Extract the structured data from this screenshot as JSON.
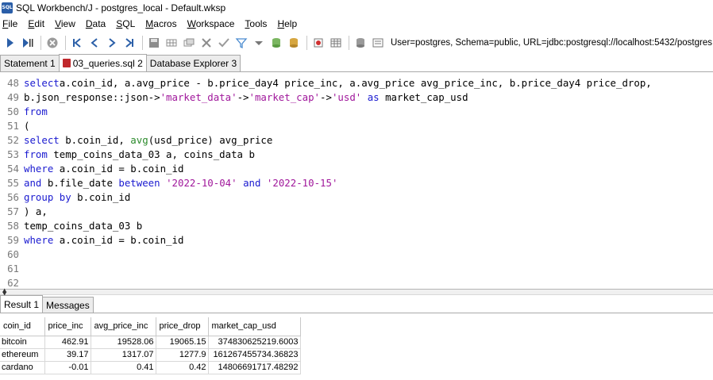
{
  "window": {
    "title": "SQL Workbench/J - postgres_local - Default.wksp",
    "icon_label": "SQL"
  },
  "menu": [
    {
      "label": "File",
      "mnemonic": "F",
      "rest": "ile"
    },
    {
      "label": "Edit",
      "mnemonic": "E",
      "rest": "dit"
    },
    {
      "label": "View",
      "mnemonic": "V",
      "rest": "iew"
    },
    {
      "label": "Data",
      "mnemonic": "D",
      "rest": "ata"
    },
    {
      "label": "SQL",
      "mnemonic": "S",
      "rest": "QL"
    },
    {
      "label": "Macros",
      "mnemonic": "M",
      "rest": "acros"
    },
    {
      "label": "Workspace",
      "mnemonic": "W",
      "rest": "orkspace"
    },
    {
      "label": "Tools",
      "mnemonic": "T",
      "rest": "ools"
    },
    {
      "label": "Help",
      "mnemonic": "H",
      "rest": "elp"
    }
  ],
  "toolbar": {
    "connection_info": "User=postgres, Schema=public, URL=jdbc:postgresql://localhost:5432/postgres",
    "icons": [
      "execute-icon",
      "execute-current-icon",
      "stop-icon",
      "first-icon",
      "previous-icon",
      "next-icon",
      "last-icon",
      "save-icon",
      "insert-row-icon",
      "copy-row-icon",
      "delete-row-icon",
      "commit-icon",
      "filter-icon",
      "filter-dropdown-icon",
      "database-commit-icon",
      "rollback-icon",
      "bug-icon",
      "table-icon",
      "db-explorer-icon",
      "options-icon"
    ]
  },
  "tabs": [
    {
      "label": "Statement 1",
      "active": false
    },
    {
      "label": "03_queries.sql 2",
      "active": true
    },
    {
      "label": "Database Explorer 3",
      "active": false
    }
  ],
  "editor": {
    "lines": [
      {
        "n": "48",
        "tokens": [
          [
            "kw",
            "select"
          ],
          [
            "",
            "a.coin_id, a.avg_price - b.price_day4 price_inc, a.avg_price avg_price_inc, b.price_day4 price_drop,"
          ]
        ]
      },
      {
        "n": "49",
        "tokens": [
          [
            "",
            "b.json_response::json->"
          ],
          [
            "str",
            "'market_data'"
          ],
          [
            "",
            "->"
          ],
          [
            "str",
            "'market_cap'"
          ],
          [
            "",
            "->"
          ],
          [
            "str",
            "'usd'"
          ],
          [
            "",
            ""
          ],
          [
            "kw",
            " as"
          ],
          [
            "",
            " market_cap_usd"
          ]
        ]
      },
      {
        "n": "50",
        "tokens": [
          [
            "kw",
            "from"
          ]
        ]
      },
      {
        "n": "51",
        "tokens": [
          [
            "",
            "("
          ]
        ]
      },
      {
        "n": "52",
        "tokens": [
          [
            "kw",
            "select"
          ],
          [
            "",
            " b.coin_id, "
          ],
          [
            "fn",
            "avg"
          ],
          [
            "",
            "(usd_price) avg_price"
          ]
        ]
      },
      {
        "n": "53",
        "tokens": [
          [
            "kw",
            "from"
          ],
          [
            "",
            " temp_coins_data_03 a, coins_data b"
          ]
        ]
      },
      {
        "n": "54",
        "tokens": [
          [
            "kw",
            "where"
          ],
          [
            "",
            " a.coin_id = b.coin_id"
          ]
        ]
      },
      {
        "n": "55",
        "tokens": [
          [
            "kw",
            "and"
          ],
          [
            "",
            " b.file_date "
          ],
          [
            "kw",
            "between"
          ],
          [
            "",
            " "
          ],
          [
            "str",
            "'2022-10-04'"
          ],
          [
            "",
            " "
          ],
          [
            "kw",
            "and"
          ],
          [
            "",
            " "
          ],
          [
            "str",
            "'2022-10-15'"
          ]
        ]
      },
      {
        "n": "56",
        "tokens": [
          [
            "kw",
            "group by"
          ],
          [
            "",
            " b.coin_id"
          ]
        ]
      },
      {
        "n": "57",
        "tokens": [
          [
            "",
            ") a,"
          ]
        ]
      },
      {
        "n": "58",
        "tokens": [
          [
            "",
            "temp_coins_data_03 b"
          ]
        ]
      },
      {
        "n": "59",
        "tokens": [
          [
            "kw",
            "where"
          ],
          [
            "",
            " a.coin_id = b.coin_id"
          ]
        ]
      },
      {
        "n": "60",
        "tokens": []
      },
      {
        "n": "61",
        "tokens": []
      },
      {
        "n": "62",
        "tokens": []
      }
    ]
  },
  "result_tabs": [
    {
      "label": "Result 1",
      "active": true
    },
    {
      "label": "Messages",
      "active": false
    }
  ],
  "results": {
    "columns": [
      "coin_id",
      "price_inc",
      "avg_price_inc",
      "price_drop",
      "market_cap_usd"
    ],
    "rows": [
      [
        "bitcoin",
        "462.91",
        "19528.06",
        "19065.15",
        "374830625219.6003"
      ],
      [
        "ethereum",
        "39.17",
        "1317.07",
        "1277.9",
        "161267455734.36823"
      ],
      [
        "cardano",
        "-0.01",
        "0.41",
        "0.42",
        "14806691717.48292"
      ]
    ]
  }
}
